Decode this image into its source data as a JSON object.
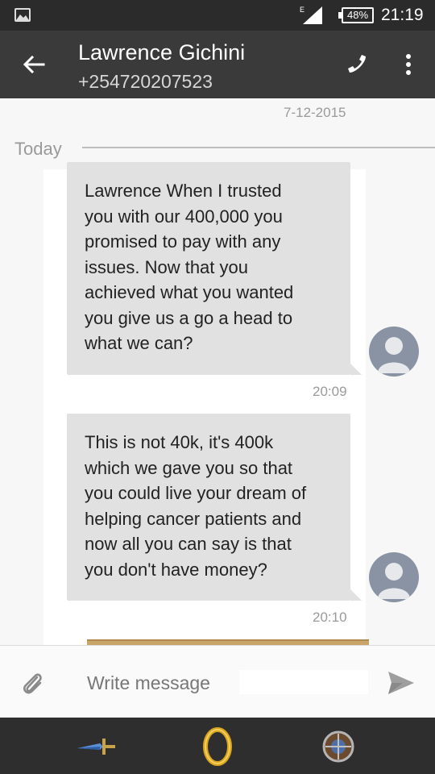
{
  "status_bar": {
    "network_type": "E",
    "battery": "48%",
    "time": "21:19"
  },
  "contact": {
    "name": "Lawrence Gichini",
    "phone": "+254720207523"
  },
  "conversation": {
    "date_header": "7-12-2015",
    "day_divider": "Today",
    "messages": [
      {
        "text": "Lawrence When I trusted\nyou with our 400,000 you\npromised to pay with any\nissues. Now that you\nachieved  what you wanted\nyou give us a go a head to\nwhat we can?",
        "time": "20:09"
      },
      {
        "text": "This is not 40k, it's 400k\nwhich we gave you so that\nyou could live your dream of\nhelping cancer patients and\nnow all you can say is that\nyou don't have money?",
        "time": "20:10"
      }
    ]
  },
  "composer": {
    "placeholder": "Write message"
  },
  "icons": {
    "back": "arrow-left-icon",
    "call": "phone-icon",
    "more": "more-vert-icon",
    "attach": "paperclip-icon",
    "send": "send-icon",
    "avatar": "person-icon"
  },
  "colors": {
    "app_bar": "#3a3a3a",
    "status_bar": "#2b2b2b",
    "bubble": "#e1e1e1",
    "avatar": "#8a93a3",
    "nav_bar": "#2e2e2e"
  }
}
